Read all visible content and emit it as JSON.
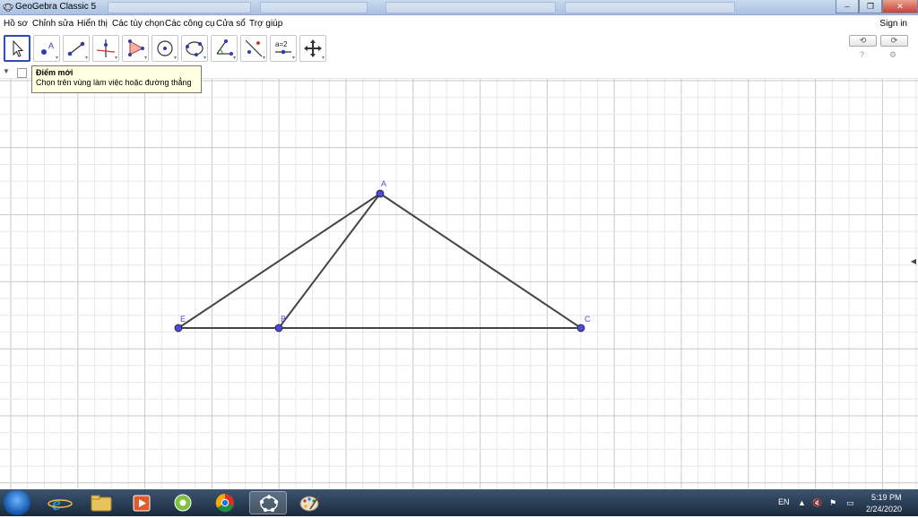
{
  "window": {
    "title": "GeoGebra Classic 5",
    "controls": {
      "minimize": "–",
      "restore": "❐",
      "close": "✕"
    }
  },
  "menu": {
    "items": [
      "Hồ sơ",
      "Chỉnh sửa",
      "Hiển thị",
      "Các tùy chọn",
      "Các công cụ",
      "Cửa sổ",
      "Trợ giúp"
    ],
    "sign_in": "Sign in"
  },
  "toolbar": {
    "tools": [
      "move-tool",
      "point-tool",
      "segment-tool",
      "perpendicular-line-tool",
      "polygon-tool",
      "circle-center-point-tool",
      "circle-three-points-tool",
      "angle-tool",
      "reflect-tool",
      "slider-tool",
      "move-graphics-view-tool"
    ],
    "active_tool": "move-tool",
    "slider_label": "a=2",
    "undo": "⟲",
    "redo": "⟳",
    "help_icon": "?",
    "settings_icon": "⚙"
  },
  "tooltip": {
    "title": "Điểm mới",
    "text": "Chọn trên vùng làm việc hoặc đường thẳng"
  },
  "graphics": {
    "point_color": "#4a4adf",
    "segment_color": "#444444",
    "points": [
      {
        "label": "A"
      },
      {
        "label": "B"
      },
      {
        "label": "C"
      },
      {
        "label": "E"
      }
    ]
  },
  "taskbar": {
    "language": "EN",
    "time": "5:19 PM",
    "date": "2/24/2020"
  }
}
